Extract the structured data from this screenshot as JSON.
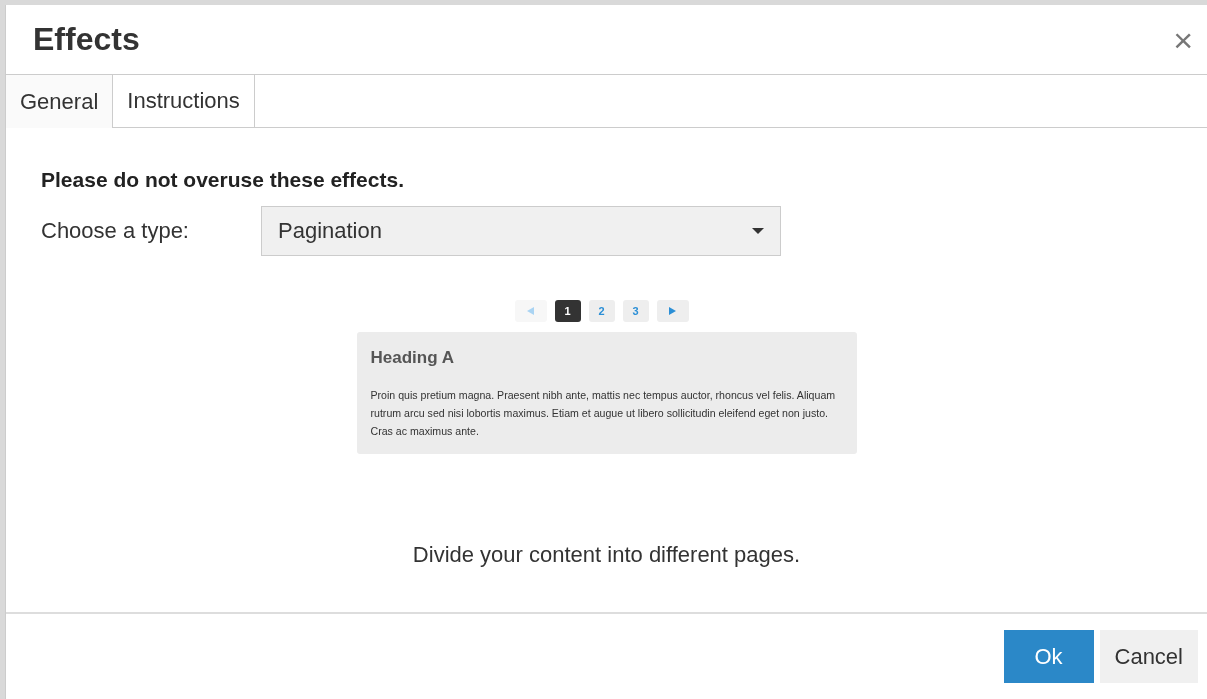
{
  "dialog": {
    "title": "Effects",
    "close": "×"
  },
  "tabs": [
    {
      "label": "General",
      "selected": true
    },
    {
      "label": "Instructions",
      "selected": false
    }
  ],
  "warning": "Please do not overuse these effects.",
  "type_field": {
    "label": "Choose a type:",
    "value": "Pagination"
  },
  "preview": {
    "pagination": {
      "prev_disabled": true,
      "pages": [
        {
          "label": "1",
          "selected": true
        },
        {
          "label": "2",
          "selected": false
        },
        {
          "label": "3",
          "selected": false
        }
      ]
    },
    "heading": "Heading A",
    "text": "Proin quis pretium magna. Praesent nibh ante, mattis nec tempus auctor, rhoncus vel felis. Aliquam rutrum arcu sed nisi lobortis maximus. Etiam et augue ut libero sollicitudin eleifend eget non justo. Cras ac maximus ante."
  },
  "description": "Divide your content into different pages.",
  "buttons": [
    {
      "label": "Ok",
      "kind": "primary"
    },
    {
      "label": "Cancel",
      "kind": "secondary"
    }
  ]
}
